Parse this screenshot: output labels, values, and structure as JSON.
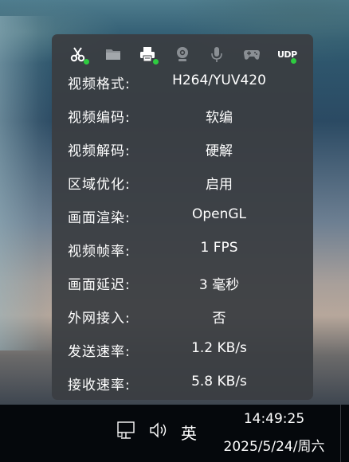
{
  "toolbar": {
    "icons": [
      {
        "name": "scissors-icon",
        "active": true
      },
      {
        "name": "folder-icon",
        "active": false
      },
      {
        "name": "printer-icon",
        "active": true
      },
      {
        "name": "webcam-icon",
        "active": false
      },
      {
        "name": "microphone-icon",
        "active": false
      },
      {
        "name": "gamepad-icon",
        "active": false
      },
      {
        "name": "udp-icon",
        "active": true,
        "label": "UDP"
      }
    ],
    "active_color": "#2ecc40",
    "inactive_color": "#8a8f94"
  },
  "stats": [
    {
      "label": "视频格式:",
      "value": "H264/YUV420"
    },
    {
      "label": "视频编码:",
      "value": "软编"
    },
    {
      "label": "视频解码:",
      "value": "硬解"
    },
    {
      "label": "区域优化:",
      "value": "启用"
    },
    {
      "label": "画面渲染:",
      "value": "OpenGL"
    },
    {
      "label": "视频帧率:",
      "value": "1 FPS"
    },
    {
      "label": "画面延迟:",
      "value": "3 毫秒"
    },
    {
      "label": "外网接入:",
      "value": "否"
    },
    {
      "label": "发送速率:",
      "value": "1.2 KB/s"
    },
    {
      "label": "接收速率:",
      "value": "5.8 KB/s"
    }
  ],
  "taskbar": {
    "ime": "英",
    "time": "14:49:25",
    "date": "2025/5/24/周六",
    "tray_icons": [
      "network-icon",
      "volume-icon"
    ]
  }
}
